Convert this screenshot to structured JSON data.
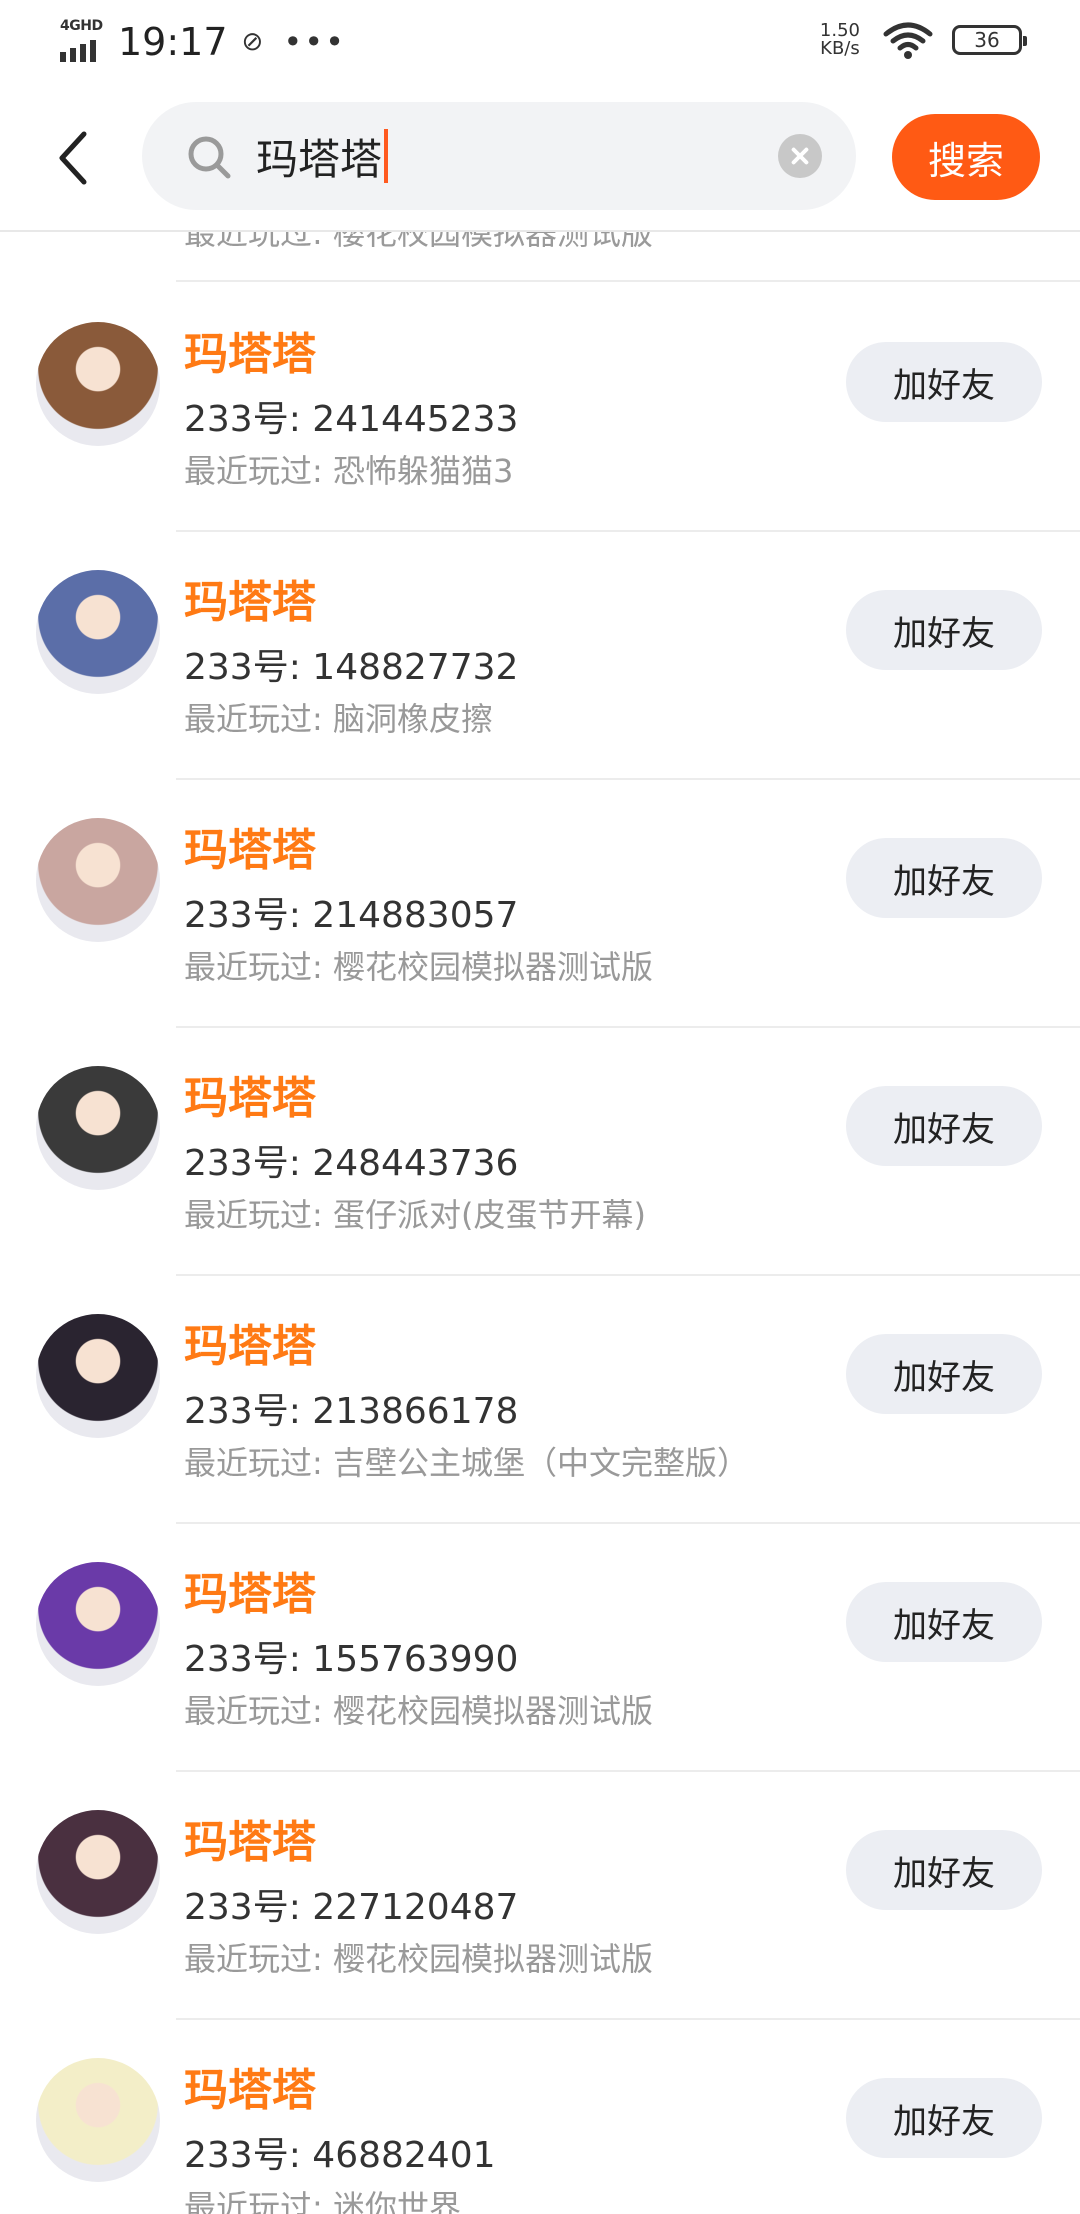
{
  "status_bar": {
    "network": "4GHD",
    "time": "19:17",
    "speed_value": "1.50",
    "speed_unit": "KB/s",
    "battery": "36"
  },
  "search": {
    "query": "玛塔塔",
    "button_label": "搜索"
  },
  "partial_top_recent": "最近玩过: 樱花校园模拟器测试版",
  "results": [
    {
      "name": "玛塔塔",
      "uid": "233号: 241445233",
      "recent": "最近玩过: 恐怖躲猫猫3",
      "button": "加好友",
      "avatar_color": "#8a5a3a"
    },
    {
      "name": "玛塔塔",
      "uid": "233号: 148827732",
      "recent": "最近玩过: 脑洞橡皮擦",
      "button": "加好友",
      "avatar_color": "#5b6ea8"
    },
    {
      "name": "玛塔塔",
      "uid": "233号: 214883057",
      "recent": "最近玩过: 樱花校园模拟器测试版",
      "button": "加好友",
      "avatar_color": "#c9a6a0"
    },
    {
      "name": "玛塔塔",
      "uid": "233号: 248443736",
      "recent": "最近玩过: 蛋仔派对(皮蛋节开幕)",
      "button": "加好友",
      "avatar_color": "#3a3a3a"
    },
    {
      "name": "玛塔塔",
      "uid": "233号: 213866178",
      "recent": "最近玩过: 吉壁公主城堡（中文完整版）",
      "button": "加好友",
      "avatar_color": "#2a2430"
    },
    {
      "name": "玛塔塔",
      "uid": "233号: 155763990",
      "recent": "最近玩过: 樱花校园模拟器测试版",
      "button": "加好友",
      "avatar_color": "#6a3aa8"
    },
    {
      "name": "玛塔塔",
      "uid": "233号: 227120487",
      "recent": "最近玩过: 樱花校园模拟器测试版",
      "button": "加好友",
      "avatar_color": "#4a3040"
    },
    {
      "name": "玛塔塔",
      "uid": "233号: 46882401",
      "recent": "最近玩过: 迷你世界",
      "button": "加好友",
      "avatar_color": "#f3eec8"
    }
  ]
}
